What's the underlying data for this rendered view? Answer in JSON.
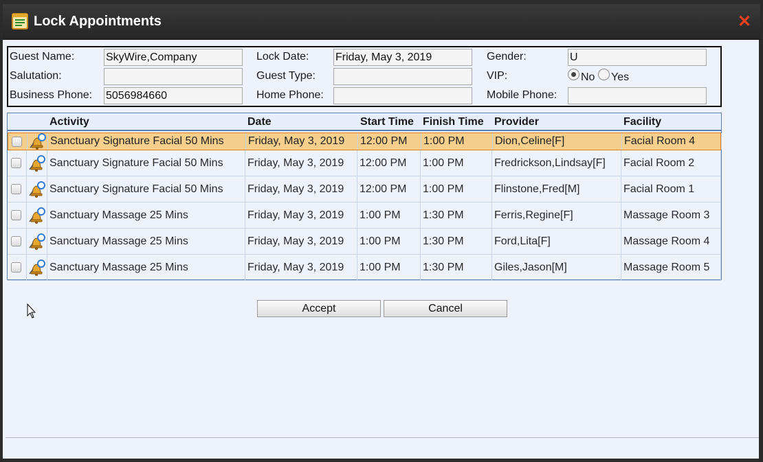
{
  "window": {
    "title": "Lock Appointments",
    "close_icon": "close-icon",
    "accent_close": "#e8401c"
  },
  "guest": {
    "guest_name_label": "Guest Name:",
    "guest_name": "SkyWire,Company",
    "salutation_label": "Salutation:",
    "salutation": "",
    "business_phone_label": "Business Phone:",
    "business_phone": "5056984660",
    "lock_date_label": "Lock Date:",
    "lock_date": "Friday, May 3, 2019",
    "guest_type_label": "Guest Type:",
    "guest_type": "",
    "home_phone_label": "Home Phone:",
    "home_phone": "",
    "gender_label": "Gender:",
    "gender": "U",
    "vip_label": "VIP:",
    "vip_no": "No",
    "vip_yes": "Yes",
    "vip_selected": "No",
    "mobile_phone_label": "Mobile Phone:",
    "mobile_phone": ""
  },
  "table": {
    "columns": [
      "Activity",
      "Date",
      "Start Time",
      "Finish Time",
      "Provider",
      "Facility"
    ],
    "selected_row_color": "#f7cf8c",
    "rows": [
      {
        "activity": "Sanctuary Signature Facial 50 Mins",
        "date": "Friday, May 3, 2019",
        "start": "12:00 PM",
        "finish": "1:00 PM",
        "provider": "Dion,Celine[F]",
        "facility": "Facial Room 4",
        "selected": true
      },
      {
        "activity": "Sanctuary Signature Facial 50 Mins",
        "date": "Friday, May 3, 2019",
        "start": "12:00 PM",
        "finish": "1:00 PM",
        "provider": "Fredrickson,Lindsay[F]",
        "facility": "Facial Room 2",
        "selected": false
      },
      {
        "activity": "Sanctuary Signature Facial 50 Mins",
        "date": "Friday, May 3, 2019",
        "start": "12:00 PM",
        "finish": "1:00 PM",
        "provider": "Flinstone,Fred[M]",
        "facility": "Facial Room 1",
        "selected": false
      },
      {
        "activity": "Sanctuary Massage 25 Mins",
        "date": "Friday, May 3, 2019",
        "start": "1:00 PM",
        "finish": "1:30 PM",
        "provider": "Ferris,Regine[F]",
        "facility": "Massage Room 3",
        "selected": false
      },
      {
        "activity": "Sanctuary Massage 25 Mins",
        "date": "Friday, May 3, 2019",
        "start": "1:00 PM",
        "finish": "1:30 PM",
        "provider": "Ford,Lita[F]",
        "facility": "Massage Room 4",
        "selected": false
      },
      {
        "activity": "Sanctuary Massage 25 Mins",
        "date": "Friday, May 3, 2019",
        "start": "1:00 PM",
        "finish": "1:30 PM",
        "provider": "Giles,Jason[M]",
        "facility": "Massage Room 5",
        "selected": false
      }
    ]
  },
  "actions": {
    "accept_label": "Accept",
    "cancel_label": "Cancel"
  }
}
